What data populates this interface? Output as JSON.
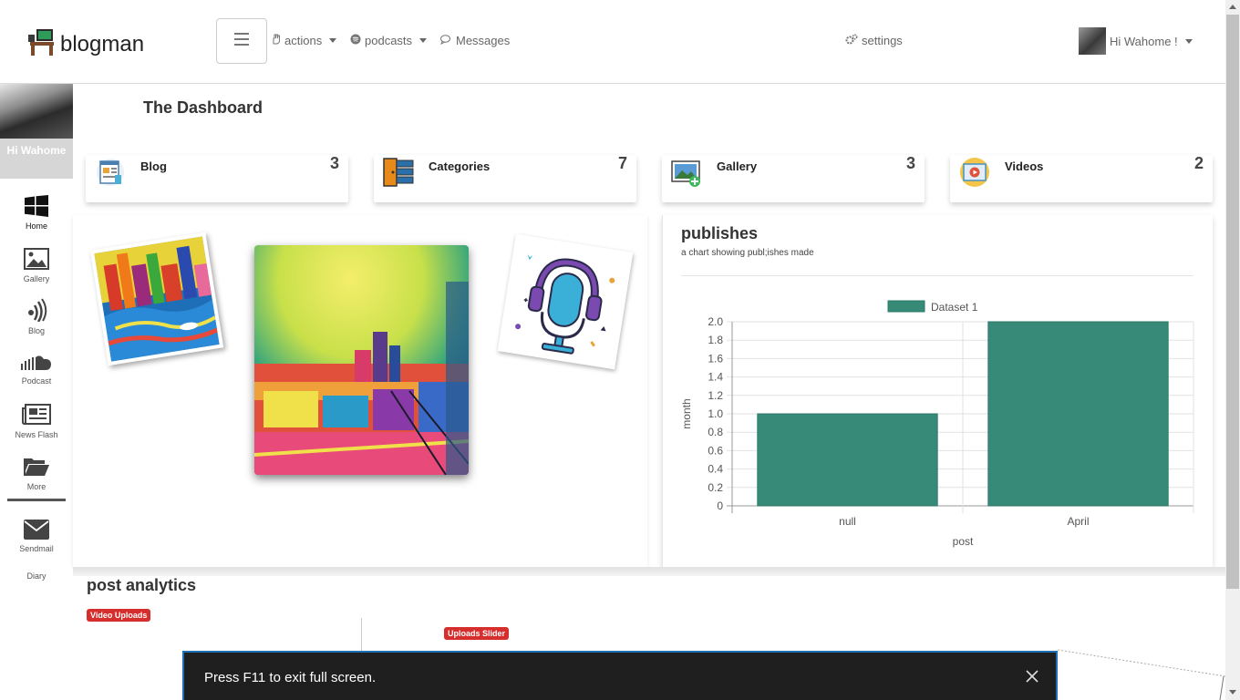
{
  "brand": {
    "name": "blogman",
    "logo_icon": "desk-computer-icon"
  },
  "navbar": {
    "menu_icon": "hamburger-icon",
    "links": [
      {
        "label": "actions",
        "icon": "hand-icon",
        "dropdown": true
      },
      {
        "label": "podcasts",
        "icon": "spotify-icon",
        "dropdown": true
      },
      {
        "label": "Messages",
        "icon": "comments-icon",
        "dropdown": false
      }
    ],
    "settings_label": "settings",
    "user_greeting": "Hi Wahome !"
  },
  "sidebar": {
    "greeting": "Hi Wahome",
    "items": [
      {
        "label": "Home",
        "icon": "windows-icon"
      },
      {
        "label": "Gallery",
        "icon": "image-icon"
      },
      {
        "label": "Blog",
        "icon": "audio-wave-icon"
      },
      {
        "label": "Podcast",
        "icon": "soundcloud-icon"
      },
      {
        "label": "News Flash",
        "icon": "newspaper-icon"
      },
      {
        "label": "More",
        "icon": "folder-open-icon"
      },
      {
        "label": "Sendmail",
        "icon": "envelope-icon"
      },
      {
        "label": "Diary",
        "icon": ""
      }
    ]
  },
  "dashboard": {
    "title": "The Dashboard",
    "cards": [
      {
        "label": "Blog",
        "count": "3"
      },
      {
        "label": "Categories",
        "count": "7"
      },
      {
        "label": "Gallery",
        "count": "3"
      },
      {
        "label": "Videos",
        "count": "2"
      }
    ]
  },
  "chart_panel": {
    "title": "publishes",
    "subtitle": "a chart showing publ;ishes made"
  },
  "chart_data": {
    "type": "bar",
    "categories": [
      "null",
      "April"
    ],
    "series": [
      {
        "name": "Dataset 1",
        "values": [
          1,
          2
        ],
        "color": "#378a78"
      }
    ],
    "xlabel": "post",
    "ylabel": "month",
    "ylim": [
      0,
      2
    ],
    "yticks": [
      "0",
      "0.2",
      "0.4",
      "0.6",
      "0.8",
      "1.0",
      "1.2",
      "1.4",
      "1.6",
      "1.8",
      "2.0"
    ],
    "legend": "top",
    "grid": true
  },
  "analytics": {
    "title": "post analytics",
    "badge_video": "Video Uploads",
    "badge_slider": "Uploads Slider"
  },
  "fullscreen_notice": {
    "text": "Press F11 to exit full screen.",
    "close_icon": "close-icon"
  },
  "colors": {
    "badge": "#d62d2d",
    "bar": "#378a78",
    "notice_border": "#1f6fb5"
  }
}
